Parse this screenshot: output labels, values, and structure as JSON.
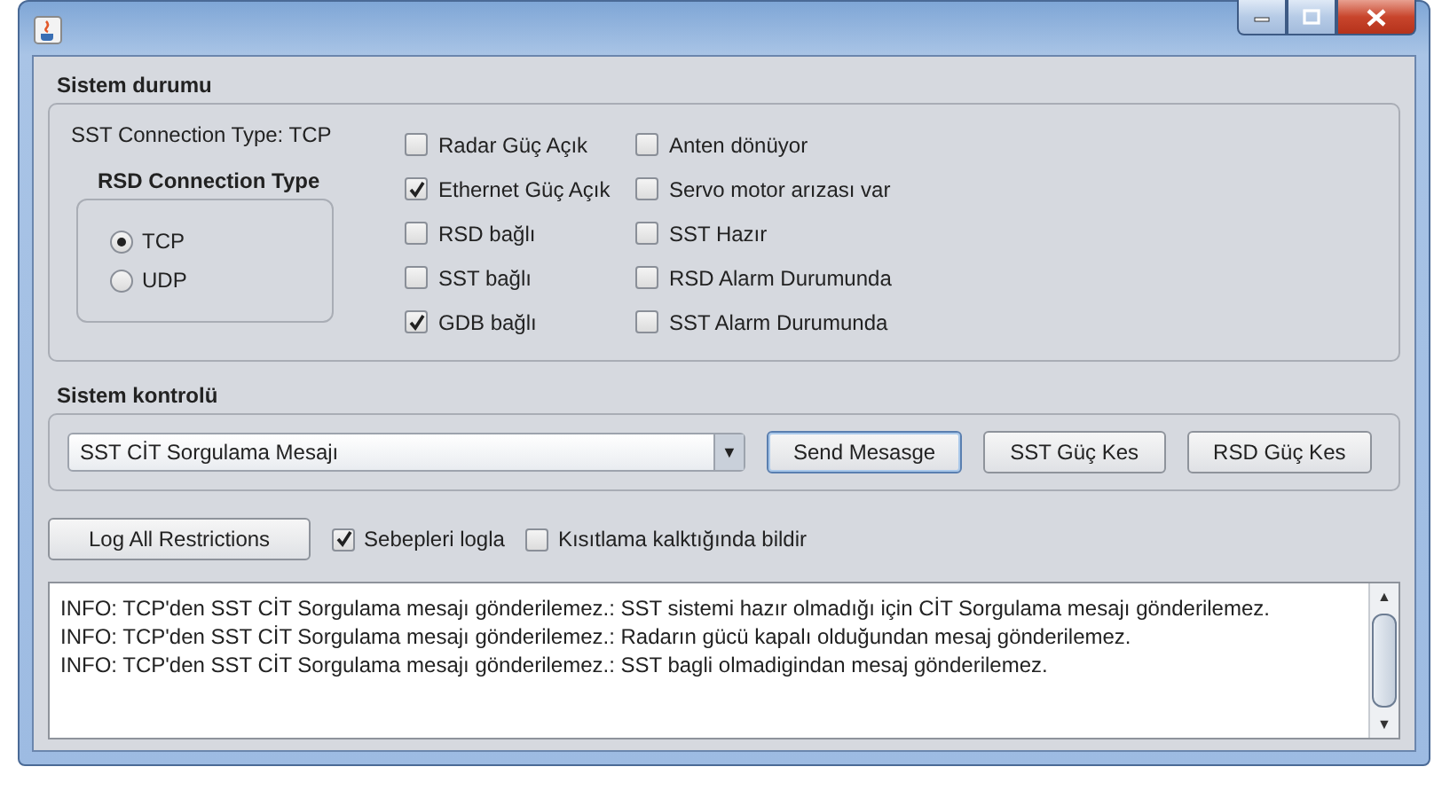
{
  "system_status": {
    "title": "Sistem durumu",
    "sst_connection": "SST Connection Type: TCP",
    "rsd_group": {
      "title": "RSD Connection Type",
      "options": [
        {
          "label": "TCP",
          "selected": true
        },
        {
          "label": "UDP",
          "selected": false
        }
      ]
    },
    "checks_column_1": [
      {
        "label": "Radar Güç Açık",
        "checked": false
      },
      {
        "label": "Ethernet Güç Açık",
        "checked": true
      },
      {
        "label": "RSD bağlı",
        "checked": false
      },
      {
        "label": "SST bağlı",
        "checked": false
      },
      {
        "label": "GDB bağlı",
        "checked": true
      }
    ],
    "checks_column_2": [
      {
        "label": "Anten dönüyor",
        "checked": false
      },
      {
        "label": "Servo motor arızası var",
        "checked": false
      },
      {
        "label": "SST Hazır",
        "checked": false
      },
      {
        "label": "RSD Alarm Durumunda",
        "checked": false
      },
      {
        "label": "SST Alarm Durumunda",
        "checked": false
      }
    ]
  },
  "system_control": {
    "title": "Sistem kontrolü",
    "dropdown": {
      "value": "SST CİT Sorgulama Mesajı",
      "arrow": "▼"
    },
    "buttons": [
      {
        "label": "Send Mesasge",
        "focused": true
      },
      {
        "label": "SST Güç Kes",
        "focused": false
      },
      {
        "label": "RSD Güç Kes",
        "focused": false
      }
    ]
  },
  "log_button": "Log All Restrictions",
  "log_options": [
    {
      "label": "Sebepleri logla",
      "checked": true
    },
    {
      "label": "Kısıtlama kalktığında bildir",
      "checked": false
    }
  ],
  "log": {
    "lines": [
      "INFO: TCP'den SST CİT Sorgulama mesajı gönderilemez.: SST sistemi hazır olmadığı için CİT Sorgulama mesajı gönderilemez.",
      "INFO: TCP'den SST CİT Sorgulama mesajı gönderilemez.: Radarın gücü kapalı olduğundan mesaj gönderilemez.",
      "INFO: TCP'den SST CİT Sorgulama mesajı gönderilemez.: SST bagli olmadigindan mesaj gönderilemez."
    ],
    "scroll_up": "▲",
    "scroll_down": "▼"
  }
}
